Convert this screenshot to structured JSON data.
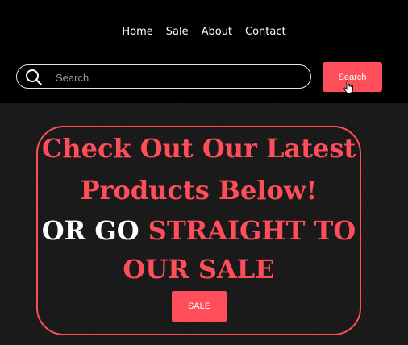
{
  "nav": {
    "items": [
      {
        "label": "Home"
      },
      {
        "label": "Sale"
      },
      {
        "label": "About"
      },
      {
        "label": "Contact"
      }
    ]
  },
  "search": {
    "placeholder": "Search",
    "value": "",
    "button_label": "Search",
    "icon": "search-icon"
  },
  "hero": {
    "line1": "Check Out Our Latest",
    "line2": "Products Below!",
    "line3_white": "OR GO ",
    "line3_red": "STRAIGHT TO",
    "line4": "OUR SALE",
    "sale_button_label": "SALE"
  },
  "colors": {
    "accent": "#ff4d5a",
    "header_bg": "#000000",
    "hero_bg": "#1a1a1a",
    "text": "#ffffff"
  }
}
